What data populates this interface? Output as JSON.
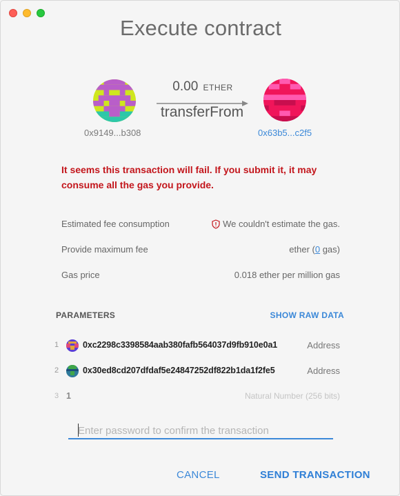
{
  "window": {
    "title": "Execute contract"
  },
  "transfer": {
    "from_address": "0x9149...b308",
    "to_address": "0x63b5...c2f5",
    "amount": "0.00",
    "unit": "ETHER",
    "method": "transferFrom"
  },
  "warning": "It seems this transaction will fail. If you submit it, it may consume all the gas you provide.",
  "fees": {
    "estimated_label": "Estimated fee consumption",
    "estimated_value": "We couldn't estimate the gas.",
    "max_fee_label": "Provide maximum fee",
    "max_fee_unit": "ether (",
    "max_fee_gas": "0",
    "max_fee_suffix": " gas)",
    "gas_price_label": "Gas price",
    "gas_price_value": "0.018 ether per million gas"
  },
  "parameters": {
    "label": "PARAMETERS",
    "show_raw": "SHOW RAW DATA",
    "rows": [
      {
        "index": "1",
        "value": "0xc2298c3398584aab380fafb564037d9fb910e0a1",
        "type": "Address"
      },
      {
        "index": "2",
        "value": "0x30ed8cd207dfdaf5e24847252df822b1da1f2fe5",
        "type": "Address"
      },
      {
        "index": "3",
        "value": "1",
        "type": "Natural Number (256 bits)"
      }
    ]
  },
  "password": {
    "placeholder": "Enter password to confirm the transaction"
  },
  "buttons": {
    "cancel": "CANCEL",
    "send": "SEND TRANSACTION"
  },
  "colors": {
    "accent": "#3b88d8",
    "error": "#c3161c"
  },
  "icons": [
    "close-dot",
    "minimize-dot",
    "zoom-dot",
    "shield-alert-icon",
    "arrow-right-icon"
  ]
}
